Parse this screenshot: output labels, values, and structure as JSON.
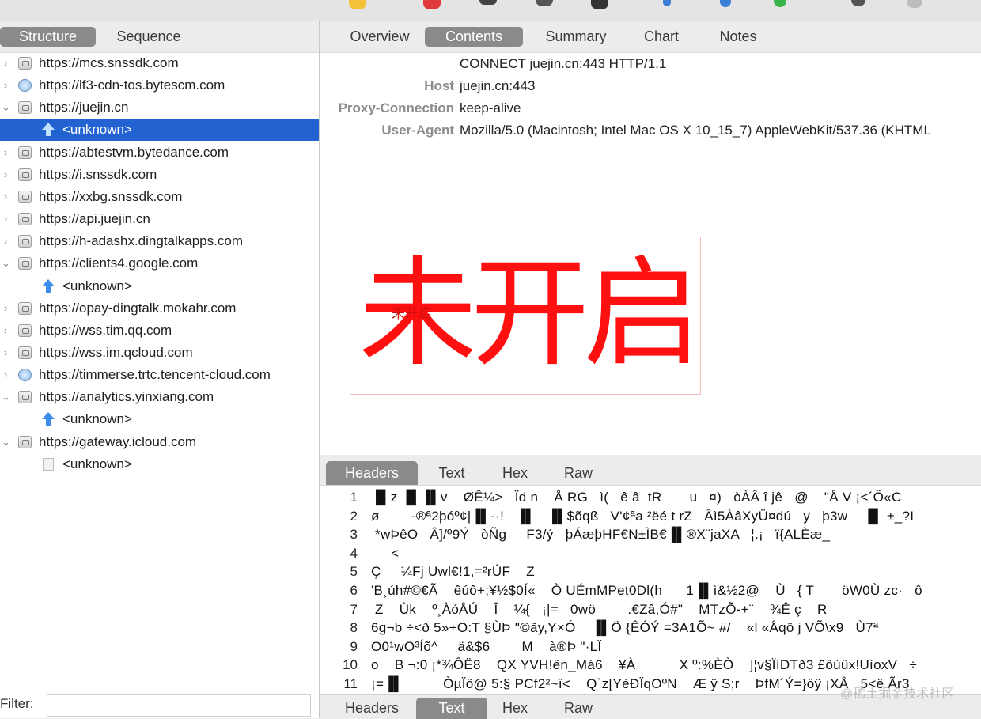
{
  "left_tabs": [
    "Structure",
    "Sequence"
  ],
  "right_tabs": [
    "Overview",
    "Contents",
    "Summary",
    "Chart",
    "Notes"
  ],
  "tree": [
    {
      "label": "https://mcs.snssdk.com",
      "icon": "lock",
      "expanded": false
    },
    {
      "label": "https://lf3-cdn-tos.bytescm.com",
      "icon": "globe",
      "expanded": false
    },
    {
      "label": "https://juejin.cn",
      "icon": "lock",
      "expanded": true
    },
    {
      "label": "<unknown>",
      "child": true,
      "icon": "upload-arrow",
      "selected": true
    },
    {
      "label": "https://abtestvm.bytedance.com",
      "icon": "lock",
      "expanded": false
    },
    {
      "label": "https://i.snssdk.com",
      "icon": "lock",
      "expanded": false
    },
    {
      "label": "https://xxbg.snssdk.com",
      "icon": "lock",
      "expanded": false
    },
    {
      "label": "https://api.juejin.cn",
      "icon": "lock",
      "expanded": false
    },
    {
      "label": "https://h-adashx.dingtalkapps.com",
      "icon": "lock",
      "expanded": false
    },
    {
      "label": "https://clients4.google.com",
      "icon": "lock",
      "expanded": true
    },
    {
      "label": "<unknown>",
      "child": true,
      "icon": "upload-arrow"
    },
    {
      "label": "https://opay-dingtalk.mokahr.com",
      "icon": "lock",
      "expanded": false
    },
    {
      "label": "https://wss.tim.qq.com",
      "icon": "lock",
      "expanded": false
    },
    {
      "label": "https://wss.im.qcloud.com",
      "icon": "lock",
      "expanded": false
    },
    {
      "label": "https://timmerse.trtc.tencent-cloud.com",
      "icon": "globe",
      "expanded": false
    },
    {
      "label": "https://analytics.yinxiang.com",
      "icon": "lock",
      "expanded": true
    },
    {
      "label": "<unknown>",
      "child": true,
      "icon": "upload-arrow"
    },
    {
      "label": "https://gateway.icloud.com",
      "icon": "lock",
      "expanded": true
    },
    {
      "label": "<unknown>",
      "child": true,
      "icon": "document"
    }
  ],
  "filter": {
    "label": "Filter:",
    "value": ""
  },
  "request": {
    "first_line": "CONNECT juejin.cn:443 HTTP/1.1",
    "headers": [
      {
        "key": "Host",
        "value": "juejin.cn:443"
      },
      {
        "key": "Proxy-Connection",
        "value": "keep-alive"
      },
      {
        "key": "User-Agent",
        "value": "Mozilla/5.0 (Macintosh; Intel Mac OS X 10_15_7) AppleWebKit/537.36 (KHTML"
      }
    ]
  },
  "stamp": {
    "text": "未开启",
    "small_text": "未开启"
  },
  "response_tabs": [
    "Headers",
    "Text",
    "Hex",
    "Raw"
  ],
  "response_lines": [
    "▐▌z ▐▌▐▌v    ØÊ¼>   Ïd n    Å RG   ì(   ê â  tR       u   ¤)   òÀÂ î jê   @    \"Å V ¡<´Ô«C",
    "ø        -®ª2þóº¢|▐▌-·!   ▐▌   ▐▌$õqß   V'¢ªa ²ëé t rZ   Âì5ÀâXyÜ¤dú   y   þ3w    ▐▌ ±_?I",
    " *wÞêO   Â]/º9Ý   òÑg     F3/ý   þÁæþHF€N±ÌB€▐▌®X¨jaXA   ¦.¡   ï{ALÈæ_",
    "     <",
    "Ç     ¼Fj Uwl€!1,=²rÚF    Z",
    "'B¸úh#©€Ã    êúô+;¥½$0Í«    Ò UÉmMPet0Dl(h      1▐▌ì&½2@    Ù   { T       öW0Ù zc·   ô",
    " Z    Ùk    º¸ÀóÅÚ    Î    ¼{   ¡|=   0wö        .€Zâ,Ó#\"    MTzÕ-+¨    ¾Ê ç    R",
    "6g¬b ÷<ð 5»+O:T §ÙÞ \"©ãy,Y×Ó    ▐▌Ö {ÊÓÝ =3A1Õ~ #/    «l «Åqô j VÕ\\x9   Ù7ª",
    "O0¹wO³Íõ^     ä&$6        M    à®Þ \"·LÏ",
    "o    B ¬:0 ¡*¾ÔË8    QX YVH!ën_Má6    ¥À           X º:%ÈÒ    ]¦v§ÏíDTð3 £ôùûx!UìoxV   ÷",
    "¡=▐▌          ÒµÏö@ 5:§ PCf2²~î<    Q`z[YèÐÏqOºN    Æ ÿ S;r    ÞfM´Ý=}öÿ ¡XÅ   5<ë Ãr3"
  ],
  "bottom_tabs": [
    "Headers",
    "Text",
    "Hex",
    "Raw"
  ],
  "active": {
    "left_tab": "Structure",
    "right_tab": "Contents",
    "response_tab": "Headers",
    "bottom_tab": "Text"
  },
  "watermark": "@稀土掘金技术社区"
}
